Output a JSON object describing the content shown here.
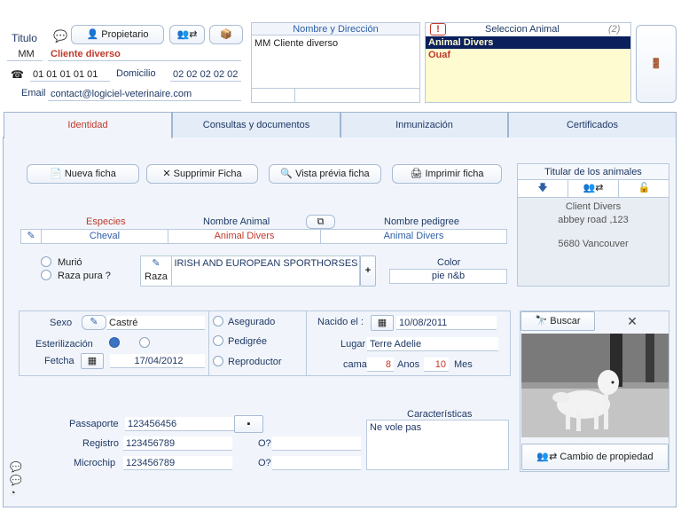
{
  "header": {
    "titulo_label": "Titulo",
    "titulo_value": "MM",
    "client_name": "Cliente diverso",
    "propietario_label": "Propietario",
    "phone1": "01 01 01 01 01",
    "domicilio_label": "Domicilio",
    "phone2": "02 02 02 02 02",
    "email_label": "Email",
    "email_value": "contact@logiciel-veterinaire.com"
  },
  "address_panel": {
    "title": "Nombre y Dirección",
    "text": "MM Cliente diverso"
  },
  "animal_select": {
    "title": "Seleccion Animal",
    "count": "(2)",
    "warn": "!",
    "items": [
      "Animal Divers",
      "Ouaf"
    ]
  },
  "tabs": [
    "Identidad",
    "Consultas y documentos",
    "Inmunización",
    "Certificados"
  ],
  "toolbar": {
    "nueva": "Nueva ficha",
    "suprimir": "Supprimir Ficha",
    "vista": "Vista prévia ficha",
    "imprimir": "Imprimir ficha"
  },
  "titular": {
    "title": "Titular de los animales",
    "line1": "Client Divers",
    "line2": "abbey road ,123",
    "line3": "5680 Vancouver"
  },
  "animal_row": {
    "especies_label": "Especies",
    "especies_value": "Cheval",
    "nombre_label": "Nombre Animal",
    "nombre_value": "Animal Divers",
    "pedigree_label": "Nombre pedigree",
    "pedigree_value": "Animal Divers"
  },
  "status": {
    "murio": "Murió",
    "raza_pura": "Raza pura ?",
    "raza_label": "Raza",
    "raza_value": "IRISH AND EUROPEAN SPORTHORSES",
    "plus": "+",
    "color_label": "Color",
    "color_value": "pie n&b"
  },
  "sexo_block": {
    "sexo_label": "Sexo",
    "sexo_value": "Castré",
    "esterilizacion_label": "Esterilización",
    "fetcha_label": "Fetcha",
    "fetcha_value": "17/04/2012"
  },
  "flags": {
    "asegurado": "Asegurado",
    "pedigree": "Pedigrée",
    "reproductor": "Reproductor"
  },
  "birth": {
    "nacido_label": "Nacido el :",
    "nacido_value": "10/08/2011",
    "lugar_label": "Lugar",
    "lugar_value": "Terre Adelie",
    "cama_label": "cama",
    "anos_value": "8",
    "anos_label": "Anos",
    "mes_value": "10",
    "mes_label": "Mes"
  },
  "photo": {
    "buscar": "Buscar",
    "close": "✕",
    "cambio": "Cambio de propiedad"
  },
  "ids": {
    "pasaporte_label": "Passaporte",
    "pasaporte_value": "123456456",
    "registro_label": "Registro",
    "registro_value": "123456789",
    "microchip_label": "Microchip",
    "microchip_value": "123456789",
    "o1_label": "O?",
    "o2_label": "O?"
  },
  "caracteristicas": {
    "title": "Características",
    "text": "Ne vole pas"
  },
  "colors": {
    "accent": "#2e5fa6",
    "red": "#c0392b",
    "select_bg": "#0a1f5c",
    "yellow": "#fffbd0"
  }
}
